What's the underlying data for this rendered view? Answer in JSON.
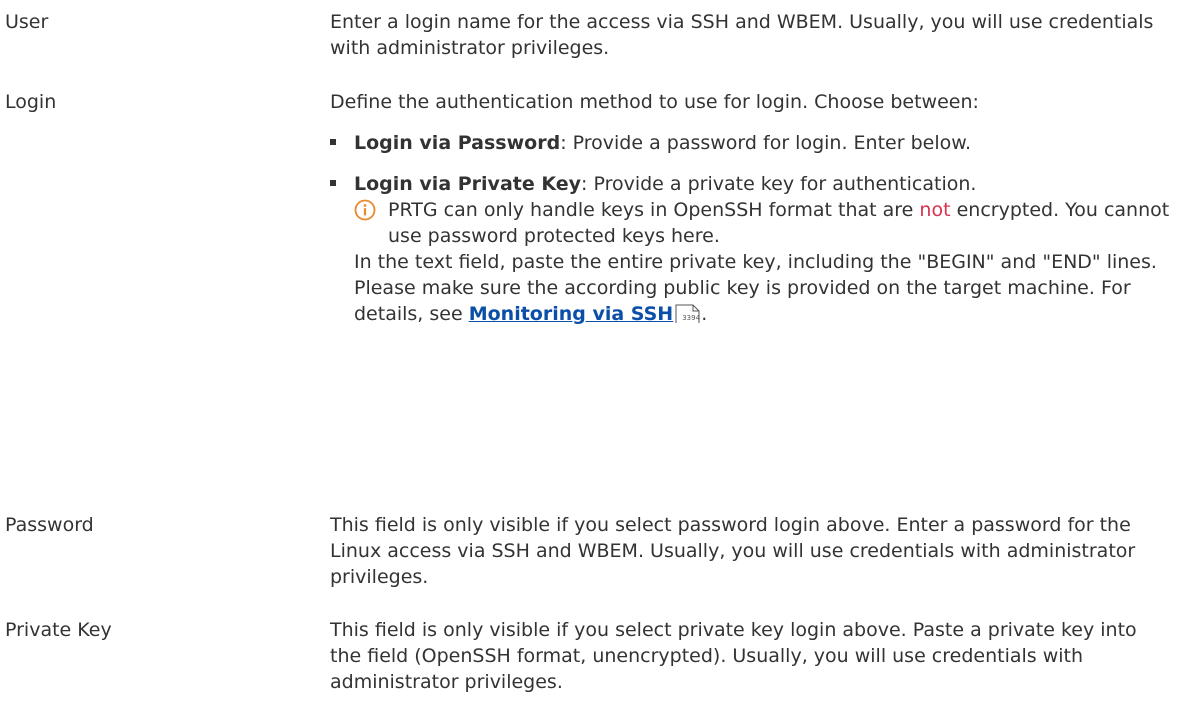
{
  "rows": [
    {
      "term": "User",
      "desc": "Enter a login name for the access via SSH and WBEM. Usually, you will use credentials with administrator privileges."
    },
    {
      "term": "Login",
      "intro": "Define the authentication method to use for login. Choose between:",
      "options": [
        {
          "title": "Login via Password",
          "text": ": Provide a password for login. Enter below."
        },
        {
          "title": "Login via Private Key",
          "text": ": Provide a private key for authentication."
        }
      ],
      "note": {
        "before": "PRTG can only handle keys in OpenSSH format that are ",
        "highlight": "not",
        "after": " encrypted. You cannot use password protected keys here."
      },
      "tail_text": "In the text field, paste the entire private key, including the \"BEGIN\" and \"END\" lines. Please make sure the according public key is provided on the target machine. For details, see ",
      "link_text": "Monitoring via SSH",
      "link_page": "3394",
      "tail_end": "."
    },
    {
      "term": "Password",
      "desc": "This field is only visible if you select password login above. Enter a password for the Linux access via SSH and WBEM. Usually, you will use credentials with administrator privileges."
    },
    {
      "term": "Private Key",
      "desc": "This field is only visible if you select private key login above. Paste a private key into the field (OpenSSH format, unencrypted). Usually, you will use credentials with administrator privileges."
    }
  ],
  "icons": {
    "note": "info-icon",
    "page_reference": "page-reference-icon"
  },
  "colors": {
    "text": "#333333",
    "link": "#0b4fa8",
    "highlight": "#d9324f",
    "info_icon": "#e8892b"
  }
}
